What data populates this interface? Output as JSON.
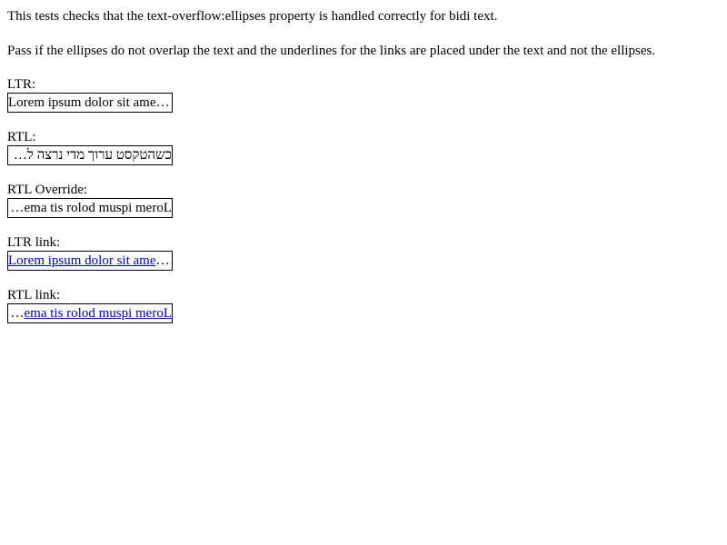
{
  "intro": {
    "line1": "This tests checks that the text-overflow:ellipses property is handled correctly for bidi text.",
    "line2": "Pass if the ellipses do not overlap the text and the underlines for the links are placed under the text and not the ellipses."
  },
  "tests": {
    "ltr": {
      "label": "LTR:",
      "text": "Lorem ipsum dolor sit amet, consectetur adipiscing elit."
    },
    "rtl": {
      "label": "RTL:",
      "text": "כשהטקסט ערוך מדי נרצה להציג אליפסה בסופו"
    },
    "rtl_override": {
      "label": "RTL Override:",
      "text": "Lorem ipsum dolor sit amet, consectetur adipiscing elit."
    },
    "ltr_link": {
      "label": "LTR link:",
      "text": "Lorem ipsum dolor sit amet, consectetur adipiscing elit."
    },
    "rtl_link": {
      "label": "RTL link:",
      "text": "Lorem ipsum dolor sit amet, consectetur adipiscing elit."
    }
  }
}
